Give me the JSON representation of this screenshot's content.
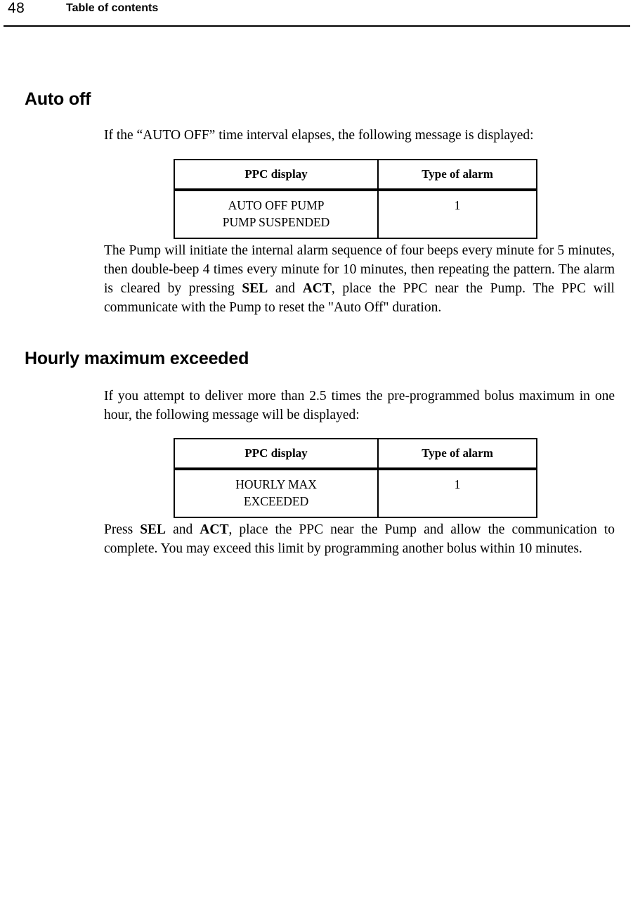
{
  "header": {
    "page_number": "48",
    "title": "Table of contents"
  },
  "sections": [
    {
      "heading": "Auto off",
      "intro": "If the “AUTO OFF” time interval elapses, the following message is displayed:",
      "table": {
        "columns": [
          "PPC display",
          "Type of alarm"
        ],
        "rows": [
          {
            "display_line_1": "AUTO OFF PUMP",
            "display_line_2": "PUMP SUSPENDED",
            "alarm_type": "1"
          }
        ]
      },
      "detail_parts": [
        {
          "text": "The Pump will initiate the internal alarm sequence of four beeps every minute for 5 minutes, then double-beep 4 times every minute for 10 minutes, then repeating the pattern. The alarm is cleared by pressing ",
          "bold": false
        },
        {
          "text": "SEL",
          "bold": true
        },
        {
          "text": " and ",
          "bold": false
        },
        {
          "text": "ACT",
          "bold": true
        },
        {
          "text": ", place the PPC near the Pump. The PPC will communicate with the Pump to reset the \"Auto Off\" duration.",
          "bold": false
        }
      ]
    },
    {
      "heading": "Hourly maximum exceeded",
      "intro": "If you attempt to deliver more than 2.5 times the pre-programmed bolus maximum in one hour, the following message will be displayed:",
      "table": {
        "columns": [
          "PPC display",
          "Type of alarm"
        ],
        "rows": [
          {
            "display_line_1": "HOURLY MAX",
            "display_line_2": "EXCEEDED",
            "alarm_type": "1"
          }
        ]
      },
      "detail_parts": [
        {
          "text": "Press ",
          "bold": false
        },
        {
          "text": "SEL",
          "bold": true
        },
        {
          "text": " and ",
          "bold": false
        },
        {
          "text": "ACT",
          "bold": true
        },
        {
          "text": ", place the PPC near the Pump and allow the communication to complete. You may exceed this limit by programming another bolus within 10 minutes.",
          "bold": false
        }
      ]
    }
  ],
  "colors": {
    "text": "#000000",
    "background": "#ffffff",
    "rule": "#000000"
  }
}
